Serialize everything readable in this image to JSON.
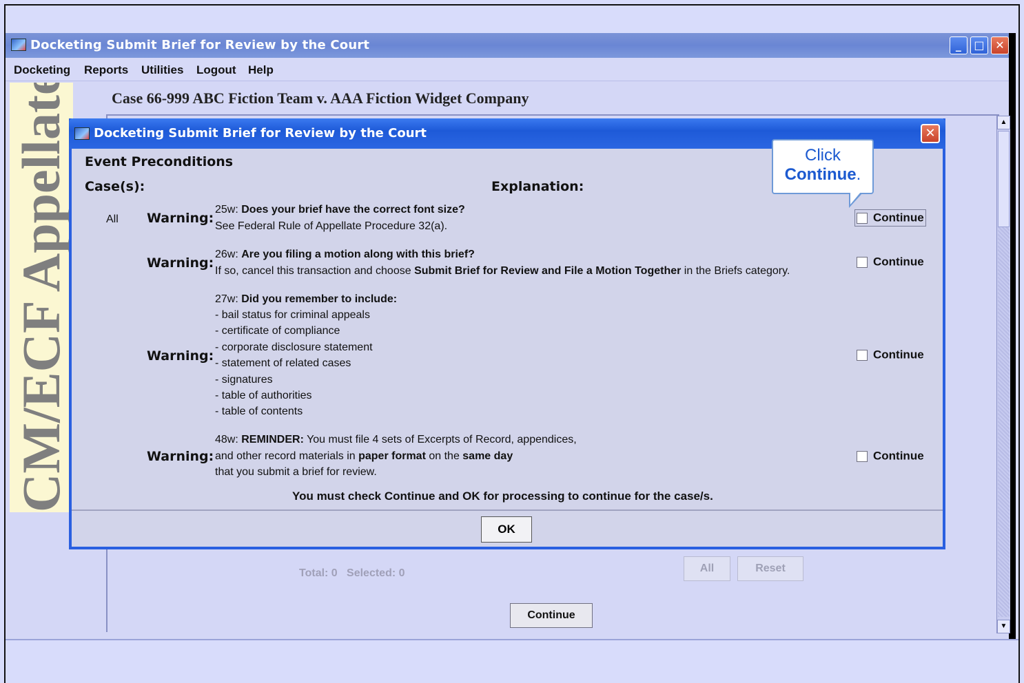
{
  "main_window": {
    "title": "Docketing Submit Brief for Review by the Court",
    "menu": [
      "Docketing",
      "Reports",
      "Utilities",
      "Logout",
      "Help"
    ],
    "side_banner": "CM/ECF Appellate",
    "case_header": "Case 66-999 ABC Fiction Team v. AAA Fiction Widget Company",
    "total_selected": "Total: 0   Selected: 0",
    "all_label": "All",
    "reset_label": "Reset",
    "continue_label": "Continue"
  },
  "dialog": {
    "title": "Docketing Submit Brief for Review by the Court",
    "section_title": "Event Preconditions",
    "cases_header": "Case(s):",
    "explanation_header": "Explanation:",
    "case_value": "All",
    "warning_label": "Warning:",
    "continue_label": "Continue",
    "warnings": [
      {
        "code": "25w:",
        "title": "Does your brief have the correct font size?",
        "line2": "See Federal Rule of Appellate Procedure 32(a)."
      },
      {
        "code": "26w:",
        "title": "Are you filing a motion along with this brief?",
        "line2_a": "If so, cancel this transaction and choose ",
        "line2_b": "Submit Brief for Review and File a Motion Together",
        "line2_c": " in the Briefs category."
      },
      {
        "code": "27w:",
        "title": "Did you remember to include:",
        "items": [
          "- bail status for criminal appeals",
          "- certificate of compliance",
          "- corporate disclosure statement",
          "- statement of related cases",
          "- signatures",
          "- table of authorities",
          "- table of contents"
        ]
      },
      {
        "code": "48w:",
        "title": "REMINDER:",
        "line1_rest": " You must file 4 sets of Excerpts of Record, appendices,",
        "line2_a": "and other record materials in ",
        "line2_b": "paper format",
        "line2_c": " on the ",
        "line2_d": "same day",
        "line3": "that you submit a brief for review."
      }
    ],
    "footer_note": "You must check Continue and OK for processing to continue for the case/s.",
    "ok_label": "OK"
  },
  "callout": {
    "line1": "Click",
    "line2": "Continue",
    "line2_suffix": "."
  },
  "colors": {
    "titlebar_blue": "#2a5fe0",
    "callout_text": "#1c5ad0",
    "background": "#d8dcfb"
  }
}
